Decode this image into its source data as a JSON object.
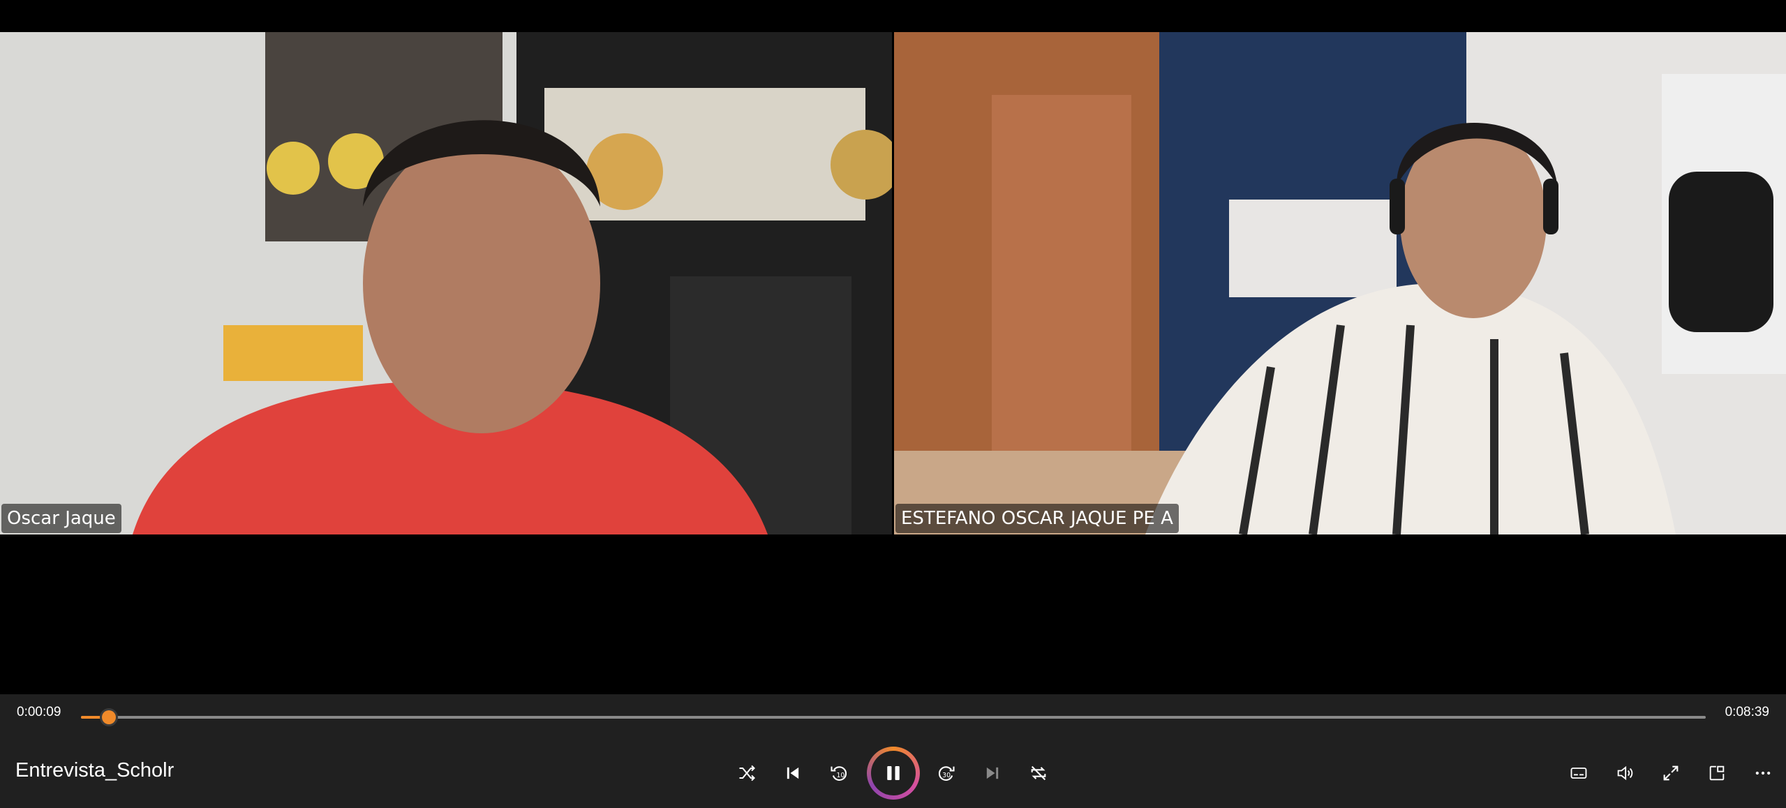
{
  "player": {
    "title": "Entrevista_Scholr",
    "time_current": "0:00:09",
    "time_total": "0:08:39",
    "progress": 0.017,
    "accent_color": "#f08a2a"
  },
  "participants": [
    {
      "name": "Oscar Jaque"
    },
    {
      "name": "ESTEFANO OSCAR JAQUE PE A"
    }
  ],
  "controls": {
    "center": [
      "shuffle-icon",
      "previous-icon",
      "rewind-10-icon",
      "pause-icon",
      "forward-30-icon",
      "next-icon",
      "repeat-off-icon"
    ],
    "right": [
      "captions-icon",
      "volume-icon",
      "fullscreen-icon",
      "mini-player-icon",
      "more-icon"
    ],
    "rewind_seconds": "10",
    "forward_seconds": "30"
  }
}
